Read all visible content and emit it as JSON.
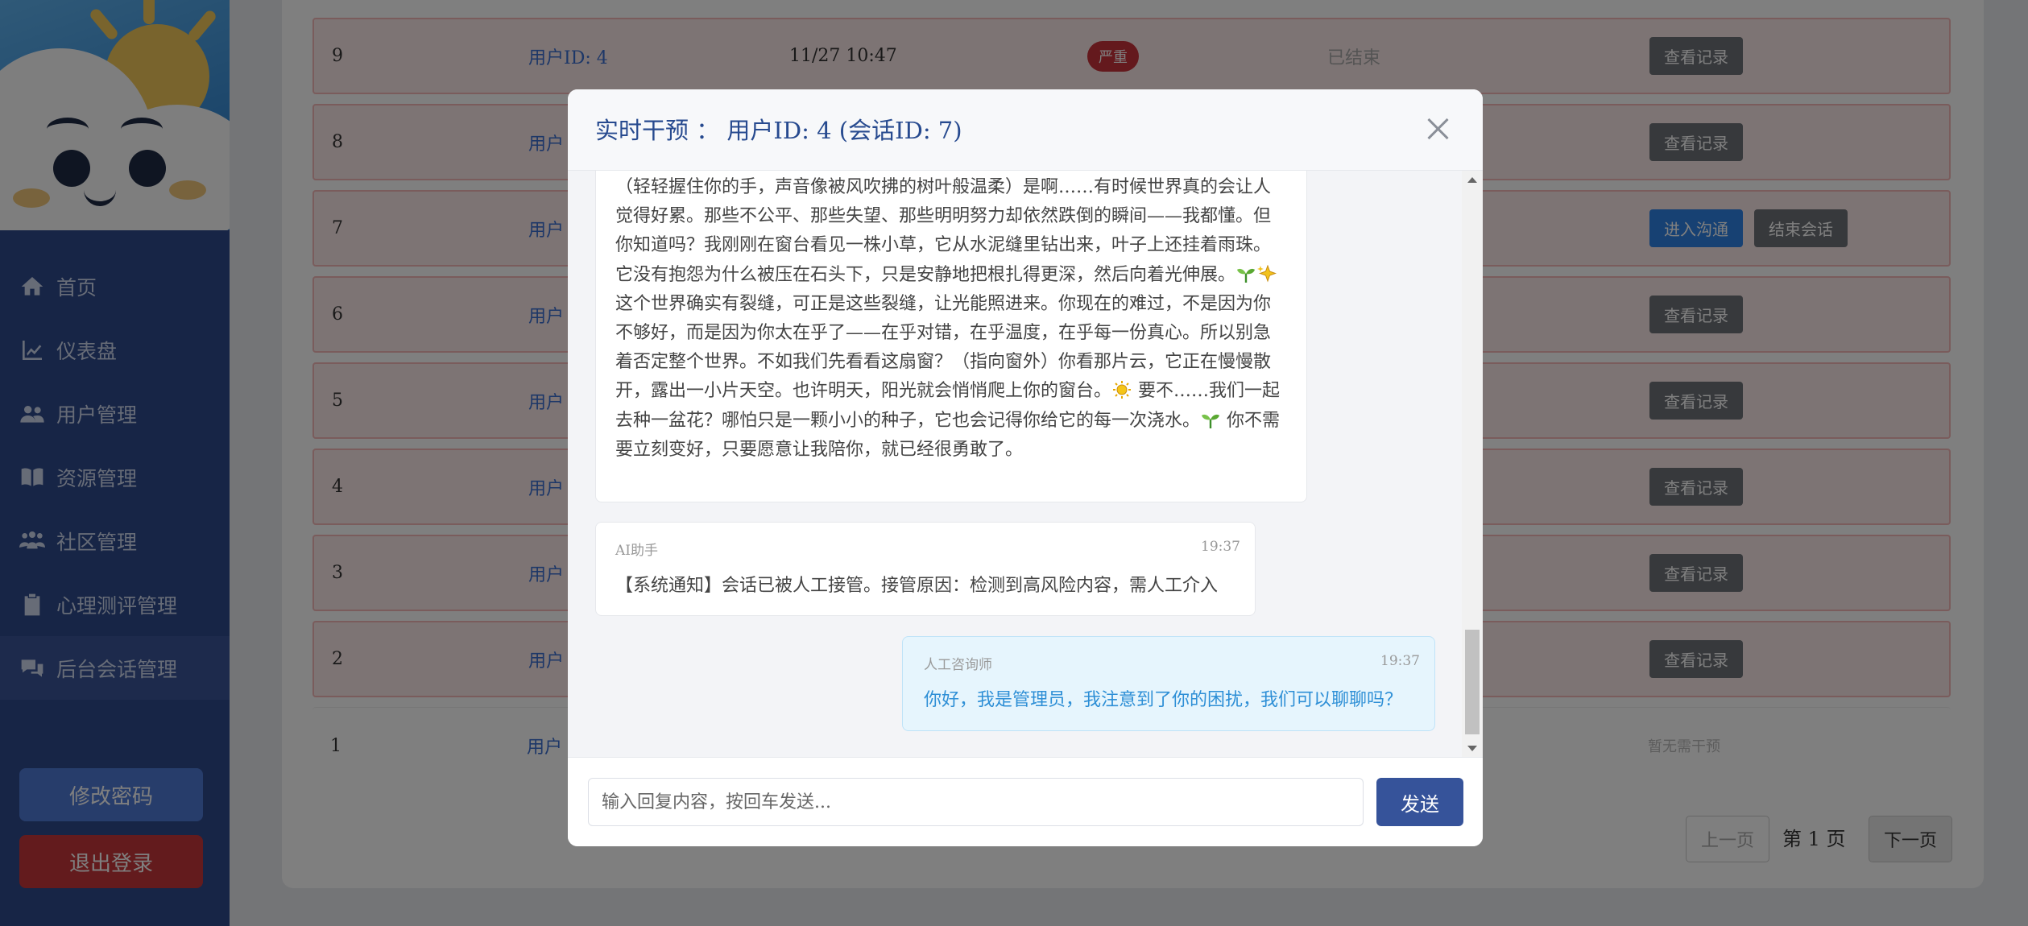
{
  "sidebar": {
    "items": [
      {
        "label": "首页",
        "icon": "home-icon"
      },
      {
        "label": "仪表盘",
        "icon": "chart-line-icon"
      },
      {
        "label": "用户管理",
        "icon": "users-icon"
      },
      {
        "label": "资源管理",
        "icon": "book-icon"
      },
      {
        "label": "社区管理",
        "icon": "community-icon"
      },
      {
        "label": "心理测评管理",
        "icon": "clipboard-icon"
      },
      {
        "label": "后台会话管理",
        "icon": "chat-icon"
      }
    ],
    "change_password": "修改密码",
    "logout": "退出登录"
  },
  "table": {
    "rows": [
      {
        "id": "9",
        "user": "用户ID: 4",
        "time": "11/27 10:47",
        "level": "严重",
        "status": "已结束",
        "actions": [
          "查看记录"
        ]
      },
      {
        "id": "8",
        "user": "用户",
        "actions": [
          "查看记录"
        ]
      },
      {
        "id": "7",
        "user": "用户",
        "actions": [
          "进入沟通",
          "结束会话"
        ]
      },
      {
        "id": "6",
        "user": "用户",
        "actions": [
          "查看记录"
        ]
      },
      {
        "id": "5",
        "user": "用户",
        "actions": [
          "查看记录"
        ]
      },
      {
        "id": "4",
        "user": "用户",
        "actions": [
          "查看记录"
        ]
      },
      {
        "id": "3",
        "user": "用户",
        "actions": [
          "查看记录"
        ]
      },
      {
        "id": "2",
        "user": "用户",
        "actions": [
          "查看记录"
        ]
      },
      {
        "id": "1",
        "user": "用户",
        "note": "暂无需干预"
      }
    ]
  },
  "pagination": {
    "prev": "上一页",
    "page_text": "第 1 页",
    "next": "下一页"
  },
  "modal": {
    "title": "实时干预 ： 用户ID: 4 (会话ID: 7)",
    "ai_message_parts": [
      "（轻轻握住你的手，声音像被风吹拂的树叶般温柔）是啊……有时候世界真的会让人觉得好累。那些不公平、那些失望、那些明明努力却依然跌倒的瞬间——我都懂。但你知道吗？我刚刚在窗台看见一株小草，它从水泥缝里钻出来，叶子上还挂着雨珠。它没有抱怨为什么被压在石头下，只是安静地把根扎得更深，然后向着光伸展。",
      " 这个世界确实有裂缝，可正是这些裂缝，让光能照进来。你现在的难过，不是因为你不够好，而是因为你太在乎了——在乎对错，在乎温度，在乎每一份真心。所以别急着否定整个世界。不如我们先看看这扇窗？（指向窗外）你看那片云，它正在慢慢散开，露出一小片天空。也许明天，阳光就会悄悄爬上你的窗台。",
      " 要不……我们一起去种一盆花？哪怕只是一颗小小的种子，它也会记得你给它的每一次浇水。",
      " 你不需要立刻变好，只要愿意让我陪你，就已经很勇敢了。"
    ],
    "system_msg": {
      "sender": "AI助手",
      "time": "19:37",
      "text": "【系统通知】会话已被人工接管。接管原因：检测到高风险内容，需人工介入"
    },
    "human_msg": {
      "sender": "人工咨询师",
      "time": "19:37",
      "text": "你好，我是管理员，我注意到了你的困扰，我们可以聊聊吗？"
    },
    "input_placeholder": "输入回复内容，按回车发送...",
    "send": "发送"
  }
}
